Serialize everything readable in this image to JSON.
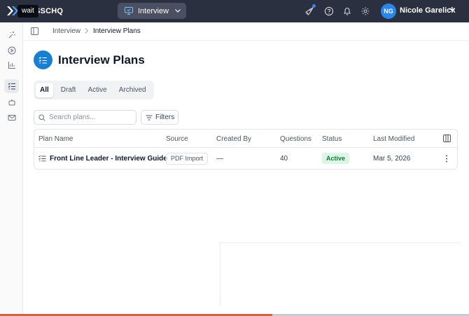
{
  "topbar": {
    "logo_text": "SSCHQ",
    "wait_tooltip": "wait",
    "workspace_label": "Interview",
    "user_initials": "NG",
    "user_name": "Nicole Garelick",
    "icons": [
      "rocket-icon",
      "help-icon",
      "bell-icon",
      "gear-icon"
    ]
  },
  "rail": {
    "items": [
      "sparkle-icon",
      "play-circle-icon",
      "bar-chart-icon",
      "checklist-icon",
      "bot-icon",
      "mail-icon"
    ],
    "active_index": 3
  },
  "breadcrumb": {
    "items": [
      "Interview",
      "Interview Plans"
    ]
  },
  "page": {
    "title": "Interview Plans"
  },
  "tabs": [
    {
      "label": "All",
      "selected": true
    },
    {
      "label": "Draft",
      "selected": false
    },
    {
      "label": "Active",
      "selected": false
    },
    {
      "label": "Archived",
      "selected": false
    }
  ],
  "search": {
    "placeholder": "Search plans...",
    "value": ""
  },
  "filters_label": "Filters",
  "table": {
    "columns": [
      "Plan Name",
      "Source",
      "Created By",
      "Questions",
      "Status",
      "Last Modified"
    ],
    "rows": [
      {
        "plan_name": "Front Line Leader - Interview Guide",
        "source": "PDF Import",
        "created_by": "—",
        "questions": "40",
        "status": "Active",
        "last_modified": "Mar 5, 2026"
      }
    ]
  },
  "progress": {
    "fraction": 0.58
  },
  "colors": {
    "topbar": "#2b3040",
    "accent": "#1b7fcf",
    "avatar": "#2a86e8",
    "status_active_bg": "#dcf5e6",
    "status_active_text": "#157a3b",
    "progress_fill": "#d0663e"
  }
}
